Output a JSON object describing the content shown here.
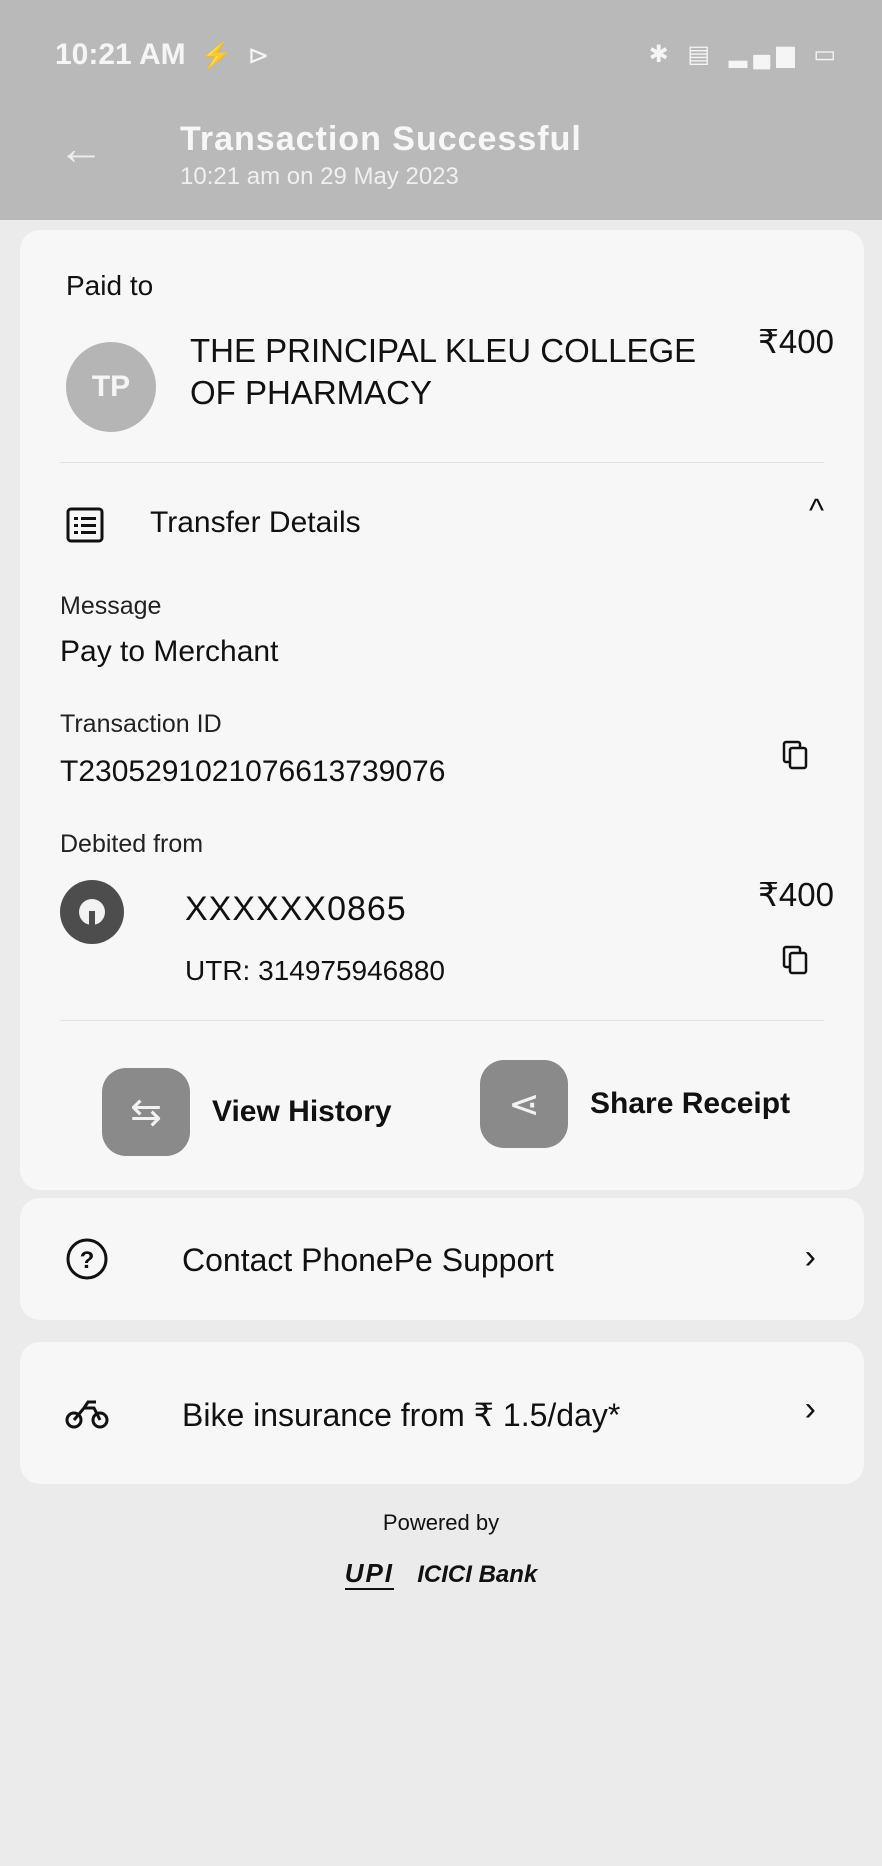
{
  "status_bar": {
    "time": "10:21 AM",
    "time_icons": "⚡ ⊳",
    "right_icons": "✱ ▤ ▂▄▆ ▭"
  },
  "header": {
    "title": "Transaction Successful",
    "subtitle": "10:21 am on 29 May 2023"
  },
  "payee": {
    "label": "Paid to",
    "initials": "TP",
    "name": "THE PRINCIPAL KLEU COLLEGE OF PHARMACY",
    "amount": "₹400"
  },
  "transfer_details": {
    "label": "Transfer Details",
    "message_label": "Message",
    "message_value": "Pay to Merchant",
    "txn_label": "Transaction ID",
    "txn_value": "T2305291021076613739076",
    "debited_label": "Debited from",
    "account": "XXXXXX0865",
    "amount": "₹400",
    "utr": "UTR: 314975946880"
  },
  "actions": {
    "history": "View History",
    "share": "Share Receipt"
  },
  "support": {
    "label": "Contact PhonePe Support"
  },
  "insurance": {
    "label": "Bike insurance from ₹ 1.5/day*"
  },
  "footer": {
    "powered_by": "Powered by",
    "upi": "UPI",
    "bank": "ICICI Bank"
  }
}
